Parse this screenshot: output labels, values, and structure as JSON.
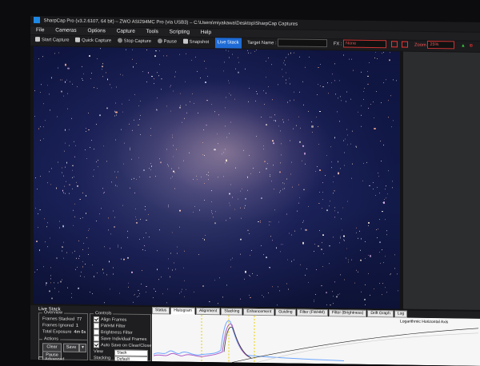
{
  "window": {
    "title": "SharpCap Pro (v3.2.6107, 64 bit) – ZWO ASI294MC Pro (via USB3) – C:\\Users\\miyakawa\\Desktop\\SharpCap Captures"
  },
  "menu": [
    "File",
    "Cameras",
    "Options",
    "Capture",
    "Tools",
    "Scripting",
    "Help"
  ],
  "toolbar": {
    "start_capture": "Start Capture",
    "quick_capture": "Quick Capture",
    "stop_capture": "Stop Capture",
    "pause": "Pause",
    "snapshot": "Snapshot",
    "live_stack": "Live Stack",
    "target_name_label": "Target Name :",
    "target_name_value": "",
    "fx_label": "FX :",
    "fx_value": "None",
    "zoom_label": "Zoom",
    "zoom_value": "25%"
  },
  "live_stack": {
    "title": "Live Stack",
    "overview": {
      "title": "Overview",
      "frames_stacked_label": "Frames Stacked",
      "frames_stacked_value": "77",
      "frames_ignored_label": "Frames Ignored",
      "frames_ignored_value": "1",
      "total_exposure_label": "Total Exposure",
      "total_exposure_value": "4m 6s"
    },
    "actions": {
      "title": "Actions",
      "clear": "Clear",
      "save": "Save",
      "pause": "Pause"
    },
    "controls": {
      "title": "Controls",
      "align_frames": "Align Frames",
      "fwhm_filter": "FWHM Filter",
      "brightness_filter": "Brightness Filter",
      "save_individual_frames": "Save Individual Frames",
      "auto_save": "Auto Save on Clear/Close",
      "view_label": "View",
      "view_value": "Stack",
      "stacking_label": "Stacking",
      "stacking_value": "Default"
    },
    "advanced": "Advanced",
    "tabs": [
      "Status",
      "Histogram",
      "Alignment",
      "Stacking",
      "Enhancement",
      "Guiding",
      "Filter (FWHM)",
      "Filter (Brightness)",
      "Drift Graph",
      "Log"
    ],
    "active_tab": "Histogram",
    "graph_label": "Logarithmic Horizontal Axis"
  },
  "colors": {
    "accent": "#1e6bd6",
    "highlight_red": "#e33333"
  }
}
